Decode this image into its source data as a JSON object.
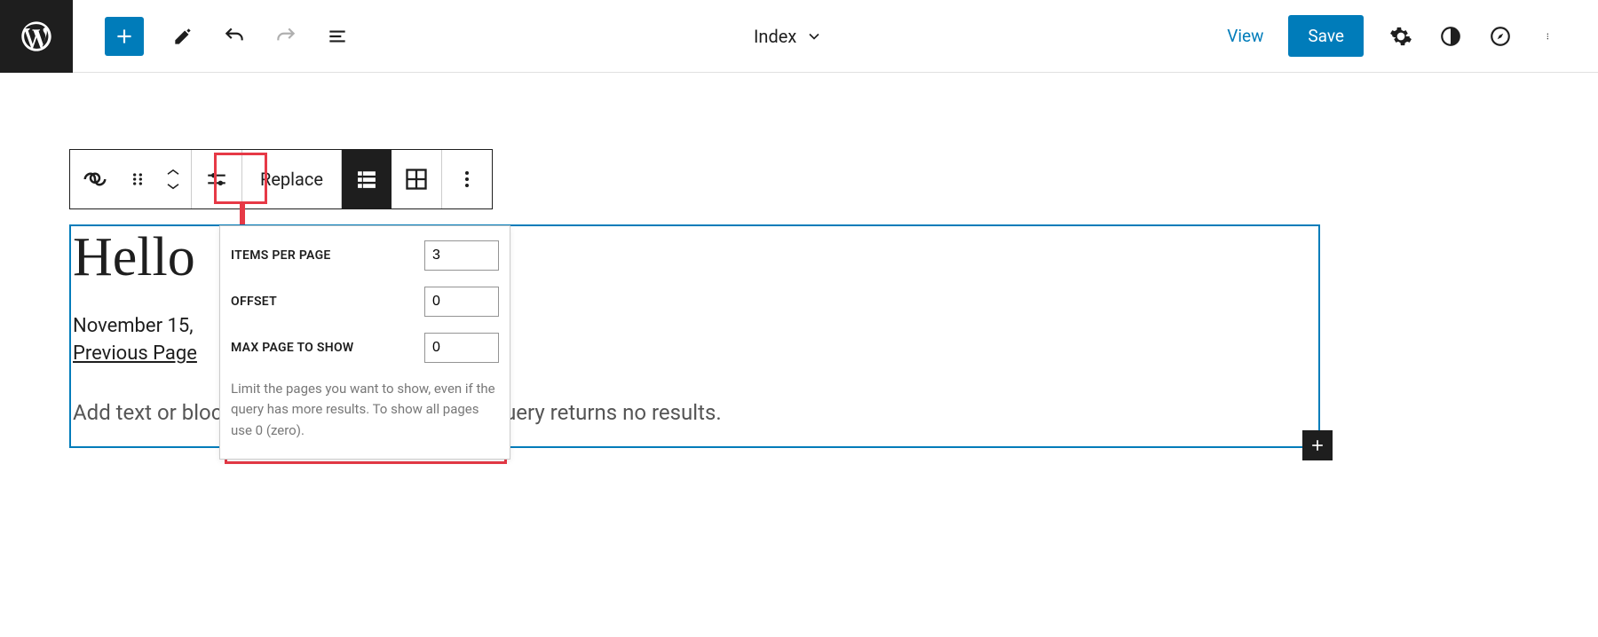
{
  "header": {
    "template_label": "Index",
    "view_label": "View",
    "save_label": "Save"
  },
  "block_toolbar": {
    "replace_label": "Replace"
  },
  "popover": {
    "items_per_page_label": "Items per page",
    "items_per_page_value": "3",
    "offset_label": "Offset",
    "offset_value": "0",
    "max_page_label": "Max page to show",
    "max_page_value": "0",
    "help_text": "Limit the pages you want to show, even if the query has more results. To show all pages use 0 (zero)."
  },
  "content": {
    "post_title": "Hello",
    "post_date": "November 15,",
    "prev_page": "Previous Page",
    "no_results_placeholder": "Add text or blocks that will display when the query returns no results."
  }
}
